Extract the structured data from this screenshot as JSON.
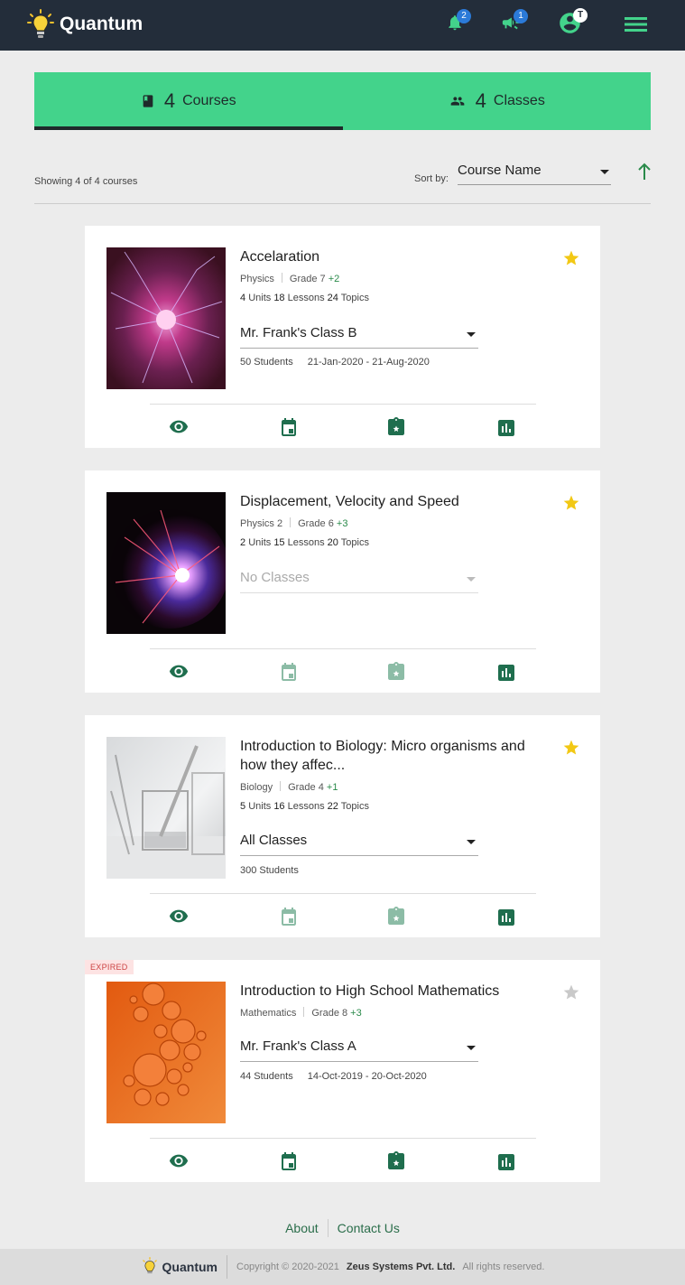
{
  "app": {
    "name": "Quantum",
    "notifications_count": "2",
    "announcements_count": "1",
    "avatar_initial": "T",
    "accent_color": "#43d38b",
    "header_color": "#232d3a"
  },
  "tabs": [
    {
      "icon": "book-icon",
      "count": "4",
      "label": "Courses",
      "active": true
    },
    {
      "icon": "people-icon",
      "count": "4",
      "label": "Classes",
      "active": false
    }
  ],
  "toolbar": {
    "showing": "Showing 4 of 4 courses",
    "sort_label": "Sort by:",
    "sort_value": "Course Name",
    "sort_direction": "ascending"
  },
  "courses": [
    {
      "title": "Accelaration",
      "subject": "Physics",
      "grade": "Grade 7",
      "grade_extra": "+2",
      "units": "4",
      "units_label": "Units",
      "lessons": "18",
      "lessons_label": "Lessons",
      "topics": "24",
      "topics_label": "Topics",
      "class": "Mr. Frank's Class B",
      "students": "50 Students",
      "dates": "21-Jan-2020 - 21-Aug-2020",
      "starred": true,
      "expired": false
    },
    {
      "title": "Displacement, Velocity and Speed",
      "subject": "Physics 2",
      "grade": "Grade 6",
      "grade_extra": "+3",
      "units": "2",
      "units_label": "Units",
      "lessons": "15",
      "lessons_label": "Lessons",
      "topics": "20",
      "topics_label": "Topics",
      "class": "No Classes",
      "students": "",
      "dates": "",
      "starred": true,
      "expired": false
    },
    {
      "title": "Introduction to Biology: Micro organisms and how they affec...",
      "subject": "Biology",
      "grade": "Grade 4",
      "grade_extra": "+1",
      "units": "5",
      "units_label": "Units",
      "lessons": "16",
      "lessons_label": "Lessons",
      "topics": "22",
      "topics_label": "Topics",
      "class": "All Classes",
      "students": "300 Students",
      "dates": "",
      "starred": true,
      "expired": false
    },
    {
      "title": "Introduction to High School Mathematics",
      "subject": "Mathematics",
      "grade": "Grade 8",
      "grade_extra": "+3",
      "units": "",
      "units_label": "",
      "lessons": "",
      "lessons_label": "",
      "topics": "",
      "topics_label": "",
      "class": "Mr. Frank's Class A",
      "students": "44 Students",
      "dates": "14-Oct-2019 - 20-Oct-2020",
      "starred": false,
      "expired": true,
      "expired_label": "EXPIRED"
    }
  ],
  "card_actions": [
    "eye-icon",
    "calendar-icon",
    "assignment-star-icon",
    "report-icon"
  ],
  "footer": {
    "about": "About",
    "contact": "Contact Us",
    "copyright": "Copyright © 2020-2021",
    "company": "Zeus Systems Pvt. Ltd.",
    "rights": "All rights reserved."
  }
}
